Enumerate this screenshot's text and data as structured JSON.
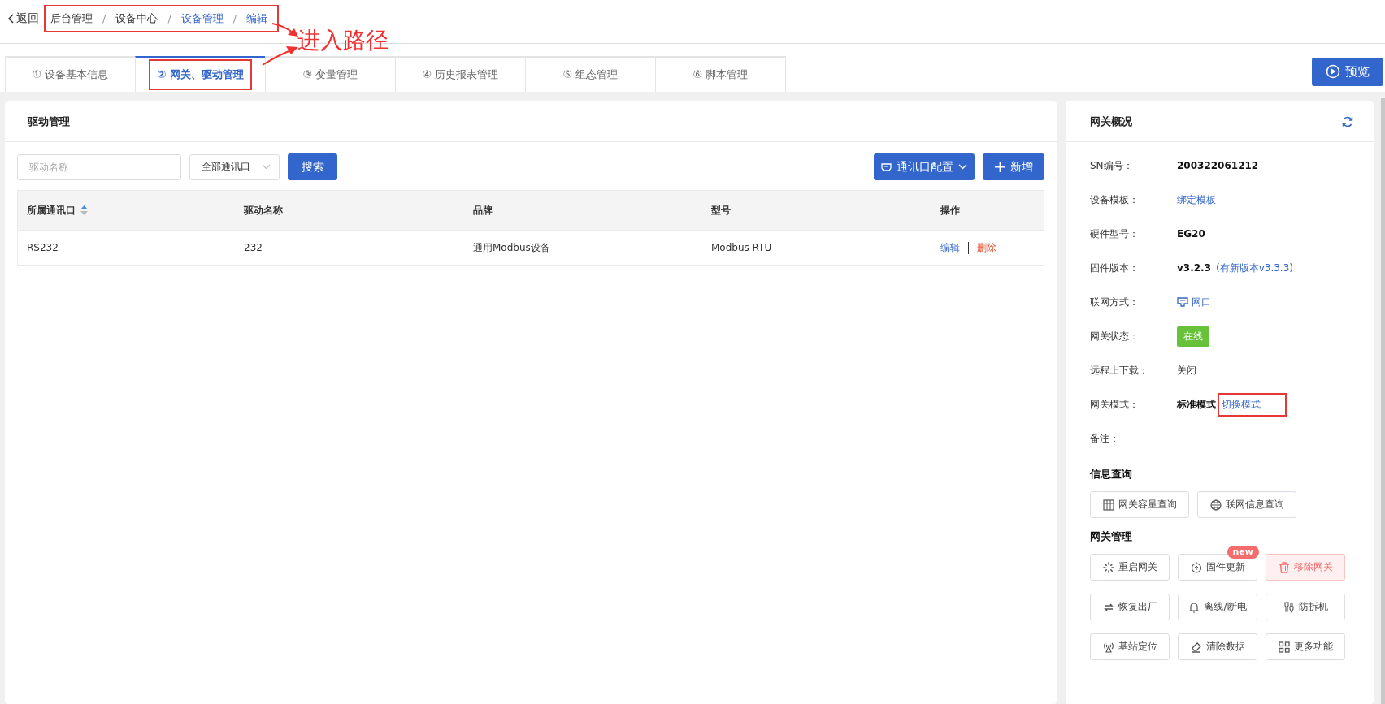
{
  "header": {
    "back": "返回",
    "breadcrumb": {
      "highlighted": true,
      "separator": "/",
      "items": [
        {
          "label": "后台管理",
          "kind": "text"
        },
        {
          "label": "设备中心",
          "kind": "text"
        },
        {
          "label": "设备管理",
          "kind": "link"
        },
        {
          "label": "编辑",
          "kind": "link"
        }
      ]
    }
  },
  "annotation": {
    "label": "进入路径"
  },
  "tabs": [
    {
      "label": "① 设备基本信息",
      "selected": false,
      "highlighted": false
    },
    {
      "label": "② 网关、驱动管理",
      "selected": true,
      "highlighted": true
    },
    {
      "label": "③ 变量管理",
      "selected": false,
      "highlighted": false
    },
    {
      "label": "④ 历史报表管理",
      "selected": false,
      "highlighted": false
    },
    {
      "label": "⑤ 组态管理",
      "selected": false,
      "highlighted": false
    },
    {
      "label": "⑥ 脚本管理",
      "selected": false,
      "highlighted": false
    }
  ],
  "preview_button": "预览",
  "driver_panel": {
    "title": "驱动管理",
    "search_placeholder": "驱动名称",
    "port_filter": "全部通讯口",
    "search_button": "搜索",
    "port_config_button": "通讯口配置",
    "add_button": "新增",
    "columns": [
      {
        "label": "所属通讯口",
        "sortable": true
      },
      {
        "label": "驱动名称",
        "sortable": false
      },
      {
        "label": "品牌",
        "sortable": false
      },
      {
        "label": "型号",
        "sortable": false
      },
      {
        "label": "操作",
        "sortable": false
      }
    ],
    "rows": [
      {
        "cells": [
          "RS232",
          "232",
          "通用Modbus设备",
          "Modbus RTU"
        ],
        "actions": [
          {
            "label": "编辑",
            "kind": "edit"
          },
          {
            "label": "删除",
            "kind": "delete"
          }
        ]
      }
    ]
  },
  "gateway": {
    "title": "网关概况",
    "fields": [
      {
        "label": "SN编号：",
        "kind": "bold",
        "value": "200322061212"
      },
      {
        "label": "设备模板：",
        "kind": "link",
        "value": "绑定模板"
      },
      {
        "label": "硬件型号：",
        "kind": "bold",
        "value": "EG20"
      },
      {
        "label": "固件版本：",
        "kind": "version",
        "value": "v3.2.3",
        "note": "(有新版本v3.3.3)"
      },
      {
        "label": "联网方式：",
        "kind": "network",
        "value": "网口"
      },
      {
        "label": "网关状态：",
        "kind": "status",
        "value": "在线",
        "color": "#67c23a"
      },
      {
        "label": "远程上下载：",
        "kind": "plain",
        "value": "关闭"
      },
      {
        "label": "网关模式：",
        "kind": "mode",
        "value": "标准模式",
        "link": "切换模式",
        "highlighted": true
      },
      {
        "label": "备注：",
        "kind": "plain"
      }
    ],
    "sections": [
      {
        "title": "信息查询",
        "buttons": [
          {
            "label": "网关容量查询",
            "kind": "normal"
          },
          {
            "label": "联网信息查询",
            "kind": "normal"
          }
        ]
      },
      {
        "title": "网关管理",
        "update_badge": "new",
        "buttons": [
          {
            "label": "重启网关",
            "kind": "normal"
          },
          {
            "label": "固件更新",
            "kind": "update"
          },
          {
            "label": "移除网关",
            "kind": "danger"
          },
          {
            "label": "恢复出厂",
            "kind": "normal"
          },
          {
            "label": "离线/断电",
            "kind": "normal"
          },
          {
            "label": "防拆机",
            "kind": "normal"
          },
          {
            "label": "基站定位",
            "kind": "normal"
          },
          {
            "label": "清除数据",
            "kind": "normal"
          },
          {
            "label": "更多功能",
            "kind": "normal"
          }
        ]
      }
    ]
  }
}
